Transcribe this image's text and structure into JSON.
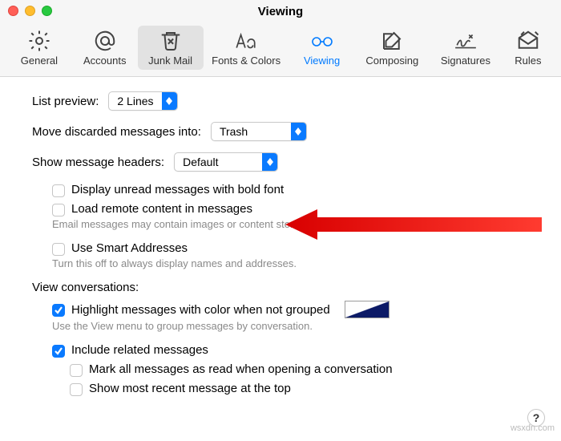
{
  "window": {
    "title": "Viewing"
  },
  "toolbar": {
    "general": "General",
    "accounts": "Accounts",
    "junk": "Junk Mail",
    "fonts": "Fonts & Colors",
    "viewing": "Viewing",
    "composing": "Composing",
    "signatures": "Signatures",
    "rules": "Rules"
  },
  "rows": {
    "list_preview_label": "List preview:",
    "list_preview_value": "2 Lines",
    "move_discarded_label": "Move discarded messages into:",
    "move_discarded_value": "Trash",
    "headers_label": "Show message headers:",
    "headers_value": "Default"
  },
  "checks": {
    "bold": "Display unread messages with bold font",
    "remote": "Load remote content in messages",
    "remote_desc": "Email messages may contain images or content stored on remote servers.",
    "smart": "Use Smart Addresses",
    "smart_desc": "Turn this off to always display names and addresses."
  },
  "conv": {
    "heading": "View conversations:",
    "highlight": "Highlight messages with color when not grouped",
    "highlight_desc": "Use the View menu to group messages by conversation.",
    "include": "Include related messages",
    "markread": "Mark all messages as read when opening a conversation",
    "recenttop": "Show most recent message at the top"
  },
  "help": "?",
  "watermark": "wsxdn.com"
}
